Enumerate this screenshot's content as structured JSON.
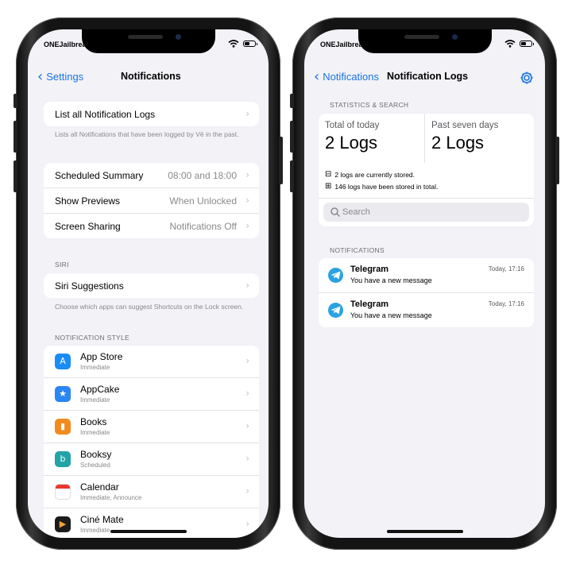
{
  "left_phone": {
    "status": {
      "carrier": "ONEJailbreak"
    },
    "nav": {
      "back_label": "Settings",
      "title": "Notifications"
    },
    "list_logs": {
      "label": "List all Notification Logs",
      "footer": "Lists all Notifications that have been logged by Vē in the past."
    },
    "general": [
      {
        "label": "Scheduled Summary",
        "value": "08:00 and 18:00"
      },
      {
        "label": "Show Previews",
        "value": "When Unlocked"
      },
      {
        "label": "Screen Sharing",
        "value": "Notifications Off"
      }
    ],
    "siri": {
      "header": "SIRI",
      "label": "Siri Suggestions",
      "footer": "Choose which apps can suggest Shortcuts on the Lock screen."
    },
    "style_header": "NOTIFICATION STYLE",
    "apps": [
      {
        "name": "App Store",
        "sub": "Immediate",
        "icon": "app-store-icon",
        "color": "#1a8cf5"
      },
      {
        "name": "AppCake",
        "sub": "Immediate",
        "icon": "appcake-icon",
        "color": "#2a86f0"
      },
      {
        "name": "Books",
        "sub": "Immediate",
        "icon": "books-icon",
        "color": "#f28a1e"
      },
      {
        "name": "Booksy",
        "sub": "Scheduled",
        "icon": "booksy-icon",
        "color": "#21a3a8"
      },
      {
        "name": "Calendar",
        "sub": "Immediate, Announce",
        "icon": "calendar-icon",
        "color": "#ffffff"
      },
      {
        "name": "Ciné Mate",
        "sub": "Immediate",
        "icon": "cine-mate-icon",
        "color": "#1b1b1b"
      }
    ]
  },
  "right_phone": {
    "status": {
      "carrier": "ONEJailbreak"
    },
    "nav": {
      "back_label": "Notifications",
      "title": "Notification Logs"
    },
    "stats_header": "STATISTICS & SEARCH",
    "today": {
      "label": "Total of today",
      "value": "2 Logs"
    },
    "week": {
      "label": "Past seven days",
      "value": "2 Logs"
    },
    "stored_now": "2 logs are currently stored.",
    "stored_total": "146 logs have been stored in total.",
    "search_placeholder": "Search",
    "notifications_header": "NOTIFICATIONS",
    "notifications": [
      {
        "app": "Telegram",
        "message": "You have a new message",
        "time": "Today, 17:16"
      },
      {
        "app": "Telegram",
        "message": "You have a new message",
        "time": "Today, 17:16"
      }
    ]
  },
  "colors": {
    "accent": "#1a73e8",
    "telegram": "#2aa3e0",
    "background": "#f2f2f7"
  }
}
